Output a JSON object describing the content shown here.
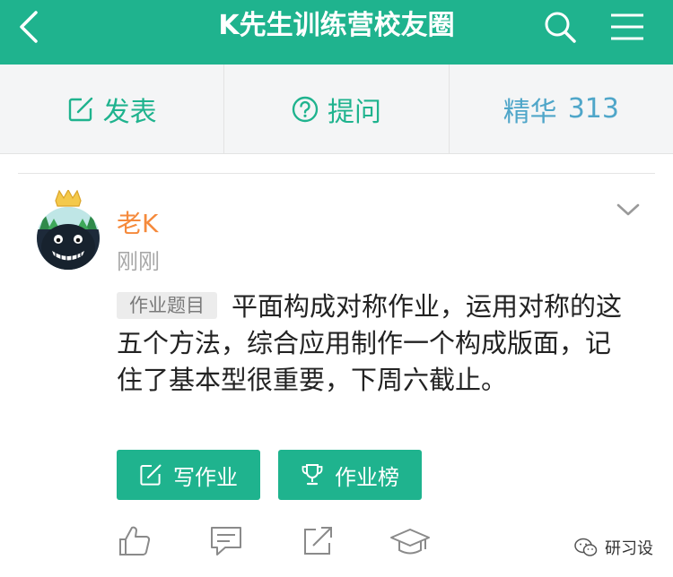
{
  "header": {
    "title": "K先生训练营校友圈",
    "background_color": "#1fb38e",
    "icons": [
      "back-icon",
      "search-icon",
      "menu-icon"
    ]
  },
  "actions": {
    "post_label": "发表",
    "ask_label": "提问",
    "featured_label": "精华",
    "featured_count": "313"
  },
  "post": {
    "author": "老K",
    "time": "刚刚",
    "tag": "作业题目",
    "text": "平面构成对称作业，运用对称的这五个方法，综合应用制作一个构成版面，记住了基本型很重要，下周六截止。",
    "write_button": "写作业",
    "rank_button": "作业榜"
  },
  "footer": {
    "icons": [
      "like-icon",
      "comment-icon",
      "share-icon",
      "graduation-cap-icon"
    ],
    "watermark": "研习设"
  },
  "colors": {
    "accent": "#1fb38e",
    "author": "#f58a3c",
    "featured": "#4fa6c9"
  }
}
